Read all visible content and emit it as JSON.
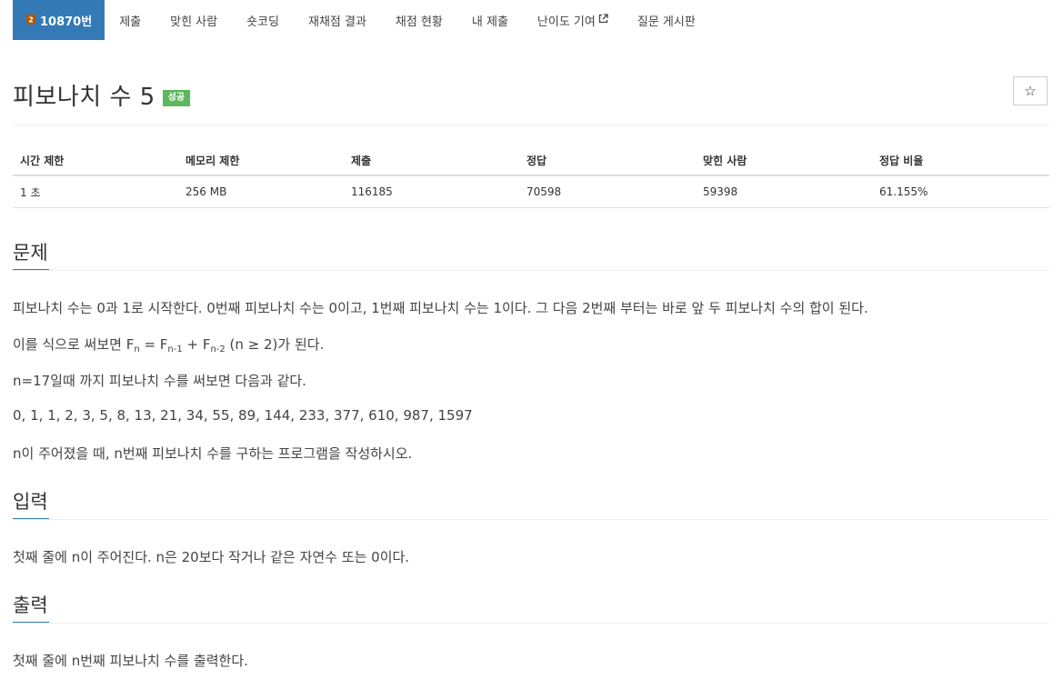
{
  "nav": {
    "items": [
      {
        "label": "10870번",
        "active": true,
        "icon": "tier-badge-icon"
      },
      {
        "label": "제출"
      },
      {
        "label": "맞힌 사람"
      },
      {
        "label": "숏코딩"
      },
      {
        "label": "재채점 결과"
      },
      {
        "label": "채점 현황"
      },
      {
        "label": "내 제출"
      },
      {
        "label": "난이도 기여",
        "icon": "external-link-icon"
      },
      {
        "label": "질문 게시판"
      }
    ]
  },
  "problem": {
    "title": "피보나치 수 5",
    "status_badge": "성공",
    "star_icon": "☆"
  },
  "info_table": {
    "headers": [
      "시간 제한",
      "메모리 제한",
      "제출",
      "정답",
      "맞힌 사람",
      "정답 비율"
    ],
    "values": [
      "1 초",
      "256 MB",
      "116185",
      "70598",
      "59398",
      "61.155%"
    ]
  },
  "sections": {
    "description": {
      "title": "문제",
      "lines": {
        "p1": "피보나치 수는 0과 1로 시작한다. 0번째 피보나치 수는 0이고, 1번째 피보나치 수는 1이다. 그 다음 2번째 부터는 바로 앞 두 피보나치 수의 합이 된다.",
        "p2_prefix": "이를 식으로 써보면 F",
        "p2_sub1": "n",
        "p2_mid1": " = F",
        "p2_sub2": "n-1",
        "p2_mid2": " + F",
        "p2_sub3": "n-2",
        "p2_suffix": " (n ≥ 2)가 된다.",
        "p3": "n=17일때 까지 피보나치 수를 써보면 다음과 같다.",
        "p4": "0, 1, 1, 2, 3, 5, 8, 13, 21, 34, 55, 89, 144, 233, 377, 610, 987, 1597",
        "p5": "n이 주어졌을 때, n번째 피보나치 수를 구하는 프로그램을 작성하시오."
      }
    },
    "input": {
      "title": "입력",
      "text": "첫째 줄에 n이 주어진다. n은 20보다 작거나 같은 자연수 또는 0이다."
    },
    "output": {
      "title": "출력",
      "text": "첫째 줄에 n번째 피보나치 수를 출력한다."
    }
  },
  "colors": {
    "nav_active": "#337ab7",
    "badge_success": "#5cb85c",
    "tier_icon": "#ad5600"
  }
}
